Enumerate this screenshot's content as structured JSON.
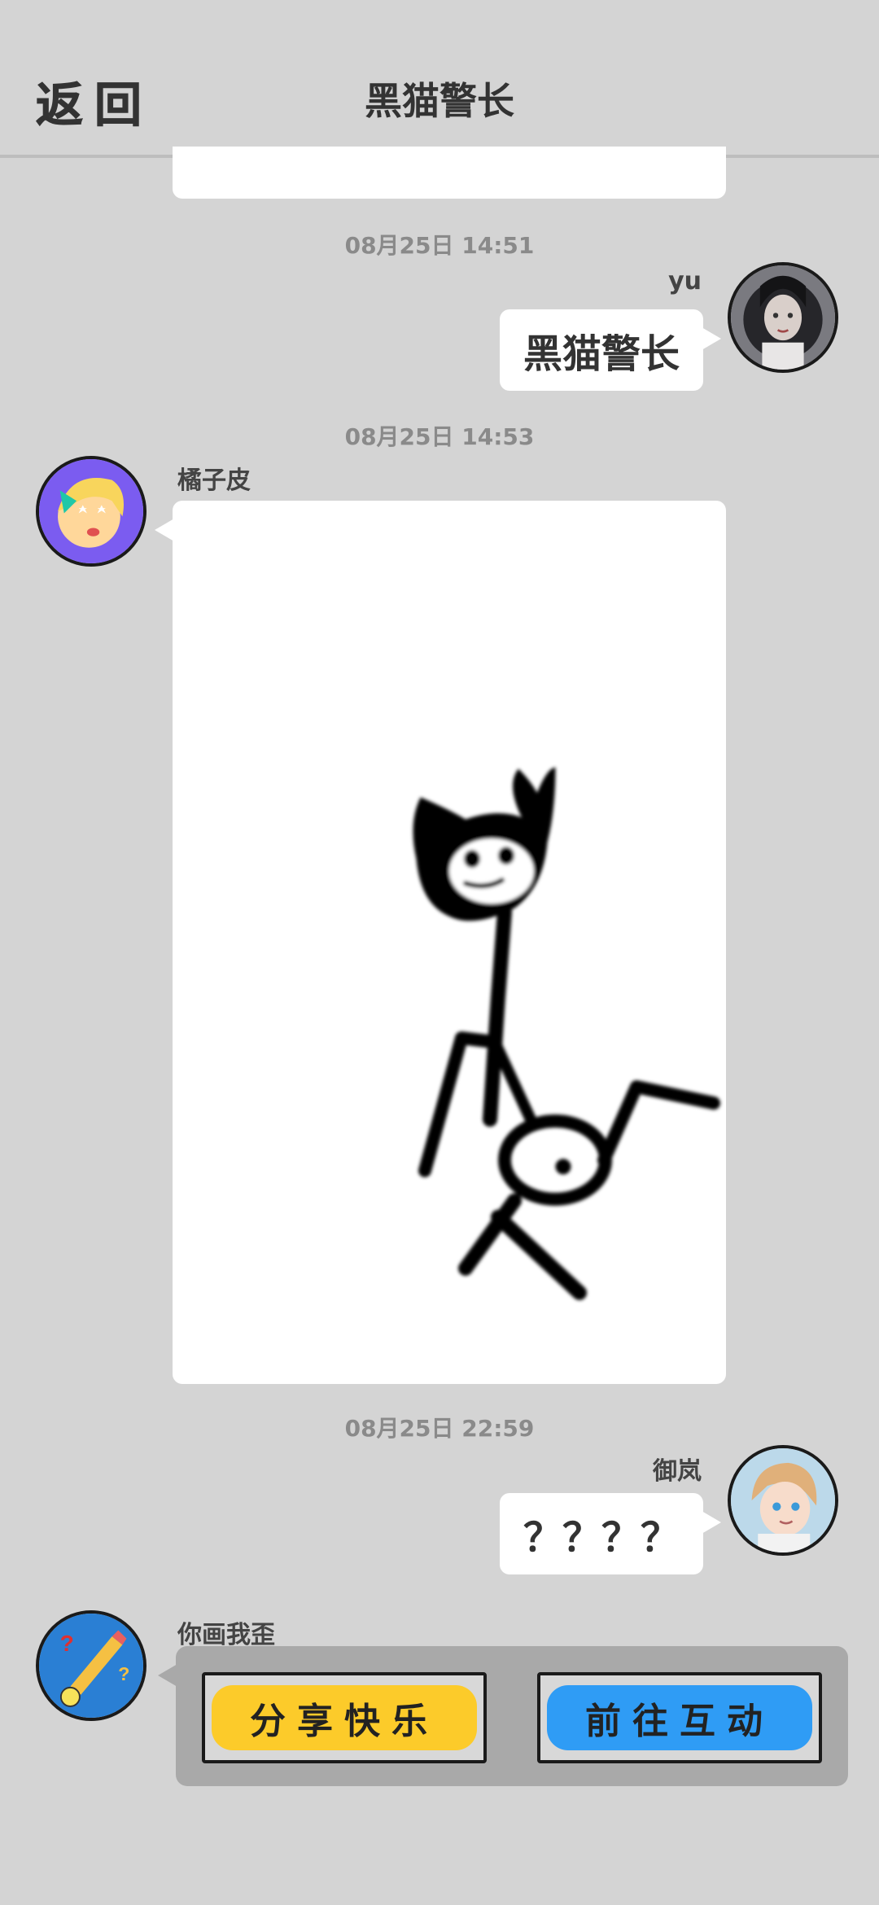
{
  "header": {
    "back_label": "返回",
    "title": "黑猫警长"
  },
  "messages": [
    {
      "time": "08月25日  14:51",
      "sender": "yu",
      "text": "黑猫警长",
      "side": "right",
      "avatar_icon": "girl-portrait-avatar-icon"
    },
    {
      "time": "08月25日  14:53",
      "sender": "橘子皮",
      "type": "drawing",
      "drawing_icon": "stick-figure-black-cat-drawing",
      "side": "left",
      "avatar_icon": "cartoon-girl-avatar-icon"
    },
    {
      "time": "08月25日  22:59",
      "sender": "御岚",
      "text": "？？？？",
      "side": "right",
      "avatar_icon": "anime-boy-avatar-icon"
    }
  ],
  "system_card": {
    "sender": "你画我歪",
    "avatar_icon": "pencil-app-avatar-icon",
    "share_label": "分享快乐",
    "share_color": "#fccb2a",
    "interact_label": "前往互动",
    "interact_color": "#2f9cf5"
  },
  "colors": {
    "background": "#d4d4d4",
    "bubble": "#ffffff",
    "text": "#333333",
    "timestamp": "#8a8a8a"
  }
}
